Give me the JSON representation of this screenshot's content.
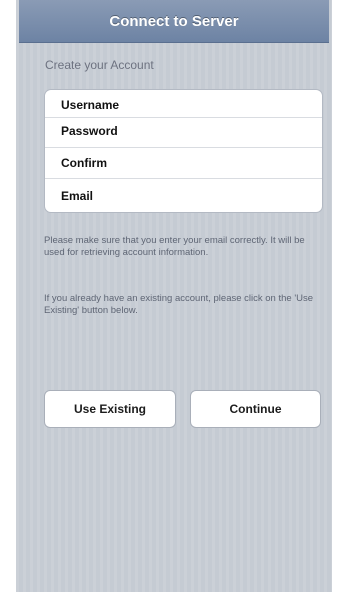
{
  "navbar": {
    "title": "Connect to Server"
  },
  "section": {
    "header": "Create your Account"
  },
  "form": {
    "fields": [
      {
        "label": "Username",
        "value": ""
      },
      {
        "label": "Password",
        "value": ""
      },
      {
        "label": "Confirm",
        "value": ""
      },
      {
        "label": "Email",
        "value": ""
      }
    ]
  },
  "info": {
    "email_note": "Please make sure that you enter your email correctly. It will be used for retrieving account information.",
    "existing_note": "If you already have an existing account, please click on the 'Use Existing' button below."
  },
  "buttons": {
    "use_existing": "Use Existing",
    "continue": "Continue"
  },
  "colors": {
    "navbar": "#7489a9",
    "background": "#c5cbd3"
  }
}
